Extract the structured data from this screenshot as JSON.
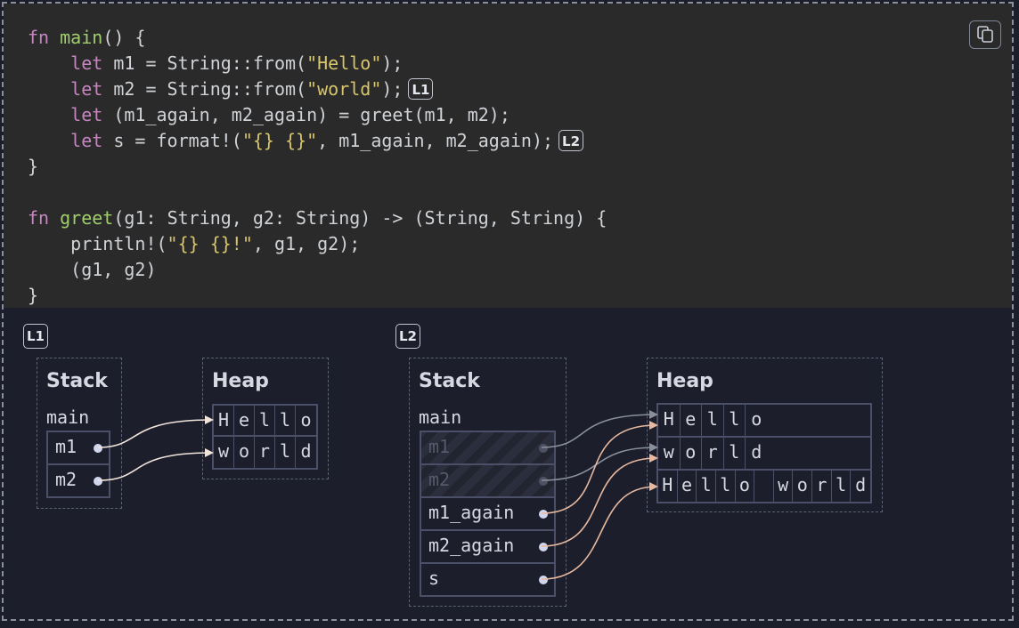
{
  "code_lines": [
    "fn main() {",
    "    let m1 = String::from(\"Hello\");",
    "    let m2 = String::from(\"world\");",
    "    let (m1_again, m2_again) = greet(m1, m2);",
    "    let s = format!(\"{} {}\", m1_again, m2_again);",
    "}",
    "",
    "fn greet(g1: String, g2: String) -> (String, String) {",
    "    println!(\"{} {}!\", g1, g2);",
    "    (g1, g2)",
    "}"
  ],
  "badges": {
    "l1": "L1",
    "l2": "L2"
  },
  "diagram": {
    "stack_title": "Stack",
    "heap_title": "Heap",
    "frame_name": "main",
    "l1_slots": [
      "m1",
      "m2"
    ],
    "l1_heap": [
      "Hello",
      "world"
    ],
    "l2_slots": [
      {
        "name": "m1",
        "moved": true
      },
      {
        "name": "m2",
        "moved": true
      },
      {
        "name": "m1_again",
        "moved": false
      },
      {
        "name": "m2_again",
        "moved": false
      },
      {
        "name": "s",
        "moved": false
      }
    ],
    "l2_heap": [
      "Hello",
      "world",
      "Hello world"
    ]
  },
  "colors": {
    "keyword": "#c586c0",
    "function": "#9fce6a",
    "string": "#d7c56b",
    "arrow_live": "#e8b9a0",
    "arrow_moved": "#8a8f9c"
  },
  "icons": [
    "copy-icon"
  ]
}
